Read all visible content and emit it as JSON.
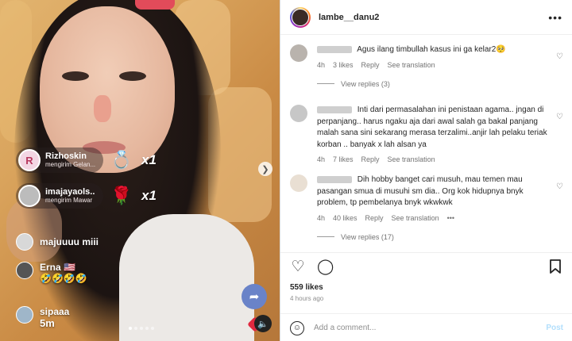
{
  "post": {
    "username": "lambe__danu2",
    "more_icon": "more-horizontal-icon",
    "likes": "559 likes",
    "time": "4 hours ago",
    "add_comment_placeholder": "Add a comment...",
    "post_label": "Post"
  },
  "live": {
    "gifts": [
      {
        "user": "Rizhoskin",
        "action": "mengirim Gelan...",
        "count": "x1",
        "avatar_letter": "R"
      },
      {
        "user": "imajayaols...",
        "action": "mengirim Mawar",
        "count": "x1",
        "avatar_letter": ""
      }
    ],
    "comments": [
      {
        "user": "majuuuu miii",
        "msg": ""
      },
      {
        "user": "Erna 🇺🇸",
        "msg": "🤣🤣🤣🤣"
      },
      {
        "user": "sipaaa",
        "msg": "5m"
      }
    ]
  },
  "comments": [
    {
      "text": "Agus ilang timbullah kasus ini ga kelar2🥺",
      "age": "4h",
      "likes": "3 likes",
      "reply": "Reply",
      "translate": "See translation",
      "replies": "View replies (3)"
    },
    {
      "text": "Inti dari permasalahan ini penistaan agama.. jngan di perpanjang.. harus ngaku aja dari awal salah ga bakal panjang malah sana sini sekarang merasa terzalimi..anjir lah pelaku teriak korban .. banyak x lah alsan ya",
      "age": "4h",
      "likes": "7 likes",
      "reply": "Reply",
      "translate": "See translation",
      "replies": ""
    },
    {
      "text": "Dih hobby banget cari musuh, mau temen mau pasangan smua di musuhi sm dia.. Org kok hidupnya bnyk problem, tp pembelanya bnyk wkwkwk",
      "age": "4h",
      "likes": "40 likes",
      "reply": "Reply",
      "translate": "See translation",
      "more": "•••",
      "replies": "View replies (17)"
    }
  ]
}
